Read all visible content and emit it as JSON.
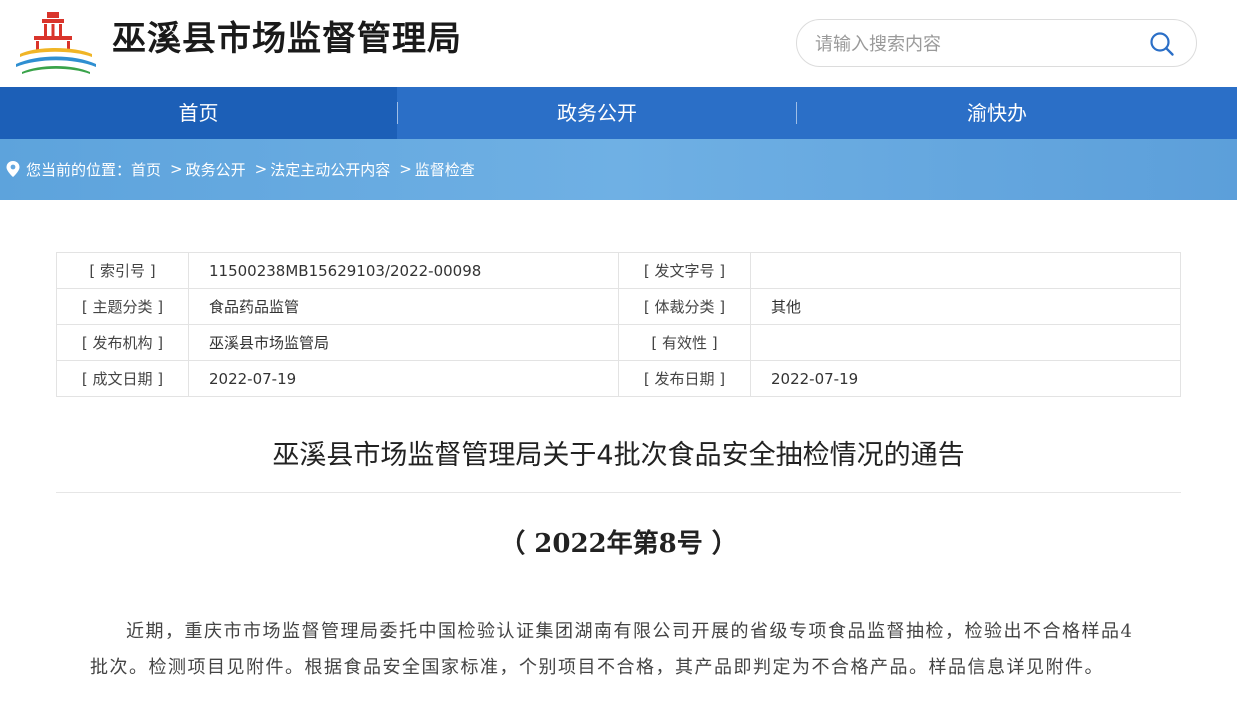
{
  "header": {
    "site_title": "巫溪县市场监督管理局",
    "logo": "county-building-logo-icon"
  },
  "search": {
    "placeholder": "请输入搜索内容",
    "icon": "search-icon"
  },
  "nav": {
    "items": [
      {
        "label": "首页",
        "active": true
      },
      {
        "label": "政务公开",
        "active": false
      },
      {
        "label": "渝快办",
        "active": false
      }
    ]
  },
  "breadcrumb": {
    "prefix": "您当前的位置：",
    "items": [
      "首页",
      "政务公开",
      "法定主动公开内容",
      "监督检查"
    ]
  },
  "meta": {
    "rows": [
      {
        "label1": "[ 索引号 ]",
        "value1": "11500238MB15629103/2022-00098",
        "label2": "[ 发文字号 ]",
        "value2": ""
      },
      {
        "label1": "[ 主题分类 ]",
        "value1": "食品药品监管",
        "label2": "[ 体裁分类 ]",
        "value2": "其他"
      },
      {
        "label1": "[ 发布机构 ]",
        "value1": "巫溪县市场监管局",
        "label2": "[ 有效性 ]",
        "value2": ""
      },
      {
        "label1": "[ 成文日期 ]",
        "value1": "2022-07-19",
        "label2": "[ 发布日期 ]",
        "value2": "2022-07-19"
      }
    ]
  },
  "article": {
    "title": "巫溪县市场监督管理局关于4批次食品安全抽检情况的通告",
    "subtitle": "（ 2022年第8号 ）",
    "body": "近期，重庆市市场监督管理局委托中国检验认证集团湖南有限公司开展的省级专项食品监督抽检，检验出不合格样品4批次。检测项目见附件。根据食品安全国家标准，个别项目不合格，其产品即判定为不合格产品。样品信息详见附件。"
  },
  "colors": {
    "nav_bg": "#2b6fc7",
    "nav_active": "#1c5fb7",
    "crumb_band": "#64a8e0"
  }
}
